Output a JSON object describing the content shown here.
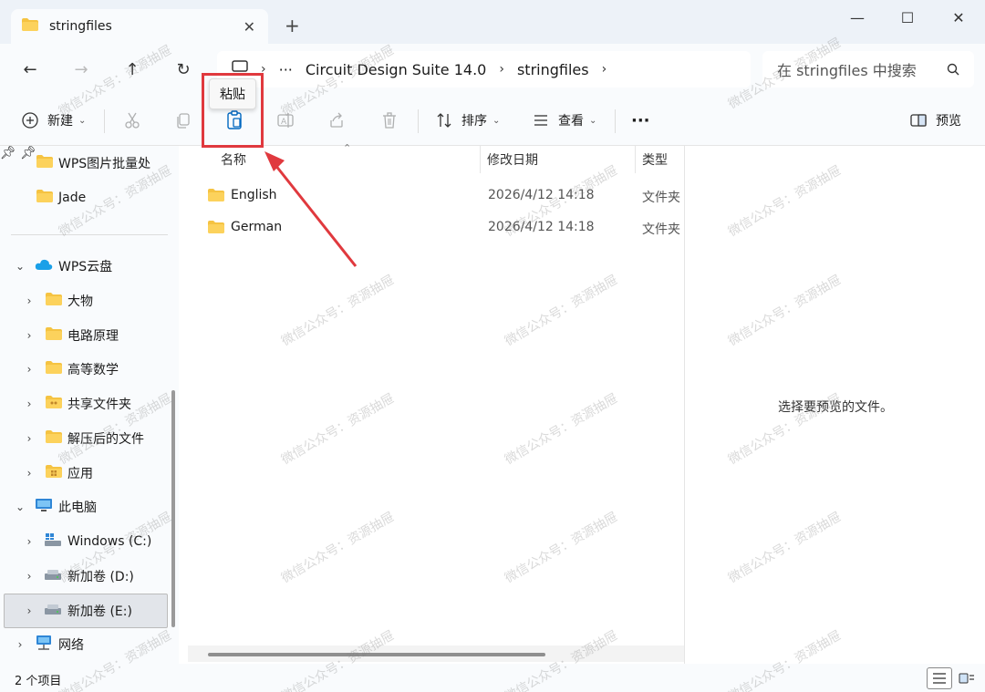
{
  "tab": {
    "title": "stringfiles",
    "close": "✕",
    "new_tab": "+"
  },
  "window": {
    "minimize": "—",
    "maximize": "☐",
    "close": "✕"
  },
  "nav": {
    "back": "←",
    "forward": "→",
    "up": "↑",
    "refresh": "↻",
    "more_path": "···"
  },
  "address": {
    "segments": [
      "Circuit Design Suite 14.0",
      "stringfiles"
    ]
  },
  "search": {
    "placeholder": "在 stringfiles 中搜索"
  },
  "toolbar": {
    "new_label": "新建",
    "sort_label": "排序",
    "view_label": "查看",
    "more": "···",
    "preview_label": "预览"
  },
  "tooltip": {
    "text": "粘贴"
  },
  "sidebar": {
    "quick": [
      {
        "label": "WPS图片批量处",
        "pinned": true
      },
      {
        "label": "Jade",
        "pinned": true
      }
    ],
    "cloud": {
      "label": "WPS云盘",
      "children": [
        "大物",
        "电路原理",
        "高等数学",
        "共享文件夹",
        "解压后的文件",
        "应用"
      ]
    },
    "pc": {
      "label": "此电脑",
      "drives": [
        "Windows (C:)",
        "新加卷 (D:)",
        "新加卷 (E:)"
      ]
    },
    "network": {
      "label": "网络"
    }
  },
  "columns": {
    "name": "名称",
    "modified": "修改日期",
    "type": "类型"
  },
  "files": [
    {
      "name": "English",
      "modified": "2026/4/12 14:18",
      "type": "文件夹"
    },
    {
      "name": "German",
      "modified": "2026/4/12 14:18",
      "type": "文件夹"
    }
  ],
  "preview": {
    "message": "选择要预览的文件。"
  },
  "status": {
    "count": "2 个项目"
  },
  "watermark": "微信公众号：资源抽屉",
  "colors": {
    "accent": "#0067c0",
    "folder": "#f5c342",
    "highlight": "#e0393e"
  }
}
